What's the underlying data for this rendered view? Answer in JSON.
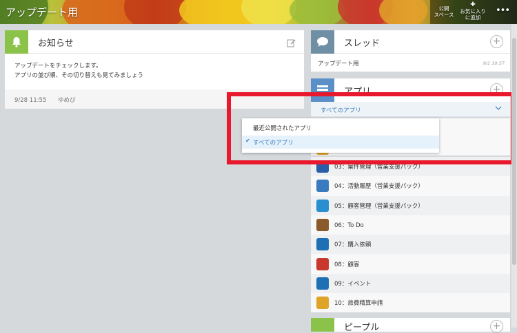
{
  "header": {
    "title": "アップデート用",
    "public_space": "公開\nスペース",
    "public_space_l1": "公開",
    "public_space_l2": "スペース",
    "favorite_l1": "お気に入り",
    "favorite_l2": "に追加",
    "more": "•••"
  },
  "notice": {
    "title": "お知らせ",
    "line1": "アップデートをチェックします。",
    "line2": "アプリの並び順、その切り替えも見てみましょう",
    "date": "9/28 11:55",
    "author": "ゆめび"
  },
  "thread": {
    "title": "スレッド",
    "item": "アップデート用",
    "date": "9/1 10:57"
  },
  "apps": {
    "title": "アプリ",
    "selected_filter": "すべてのアプリ",
    "options": [
      "最近公開されたアプリ",
      "すべてのアプリ"
    ],
    "items": [
      {
        "label": "03：案件管理（営業支援パック）",
        "icon": "x-sheet-icon",
        "color": "#2a5fa8"
      },
      {
        "label": "04：活動履歴（営業支援パック）",
        "icon": "edit-note-icon",
        "color": "#3a7bbf"
      },
      {
        "label": "05：顧客管理（営業支援パック）",
        "icon": "id-card-icon",
        "color": "#2a8fd1"
      },
      {
        "label": "06：To Do",
        "icon": "clipboard-check-icon",
        "color": "#8a5a2a"
      },
      {
        "label": "07：購入依頼",
        "icon": "paperclip-icon",
        "color": "#1f6fb5"
      },
      {
        "label": "08：顧客",
        "icon": "binders-icon",
        "color": "#c9382c"
      },
      {
        "label": "09：イベント",
        "icon": "paperclip-icon",
        "color": "#1f6fb5"
      },
      {
        "label": "10：旅費精算申請",
        "icon": "bus-icon",
        "color": "#e0a32a"
      }
    ]
  },
  "people": {
    "title": "ピープル"
  },
  "colors": {
    "accent": "#3a7bbf",
    "highlight": "#e8192c",
    "notice_icon": "#8bc34a"
  }
}
